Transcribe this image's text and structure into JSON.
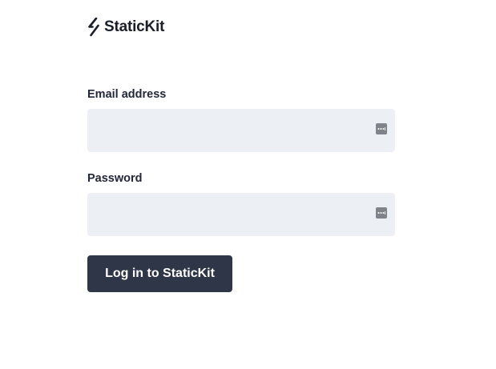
{
  "brand": {
    "name": "StaticKit",
    "logo_icon": "slash-bolt-icon"
  },
  "form": {
    "email": {
      "label": "Email address",
      "value": "",
      "placeholder": "",
      "icon": "password-manager-icon"
    },
    "password": {
      "label": "Password",
      "value": "",
      "placeholder": "",
      "icon": "password-manager-icon"
    },
    "submit_label": "Log in to StaticKit"
  },
  "colors": {
    "input_background": "#ecf0f4",
    "button_background": "#2e3647",
    "button_text": "#ffffff",
    "text": "#1f2533"
  }
}
